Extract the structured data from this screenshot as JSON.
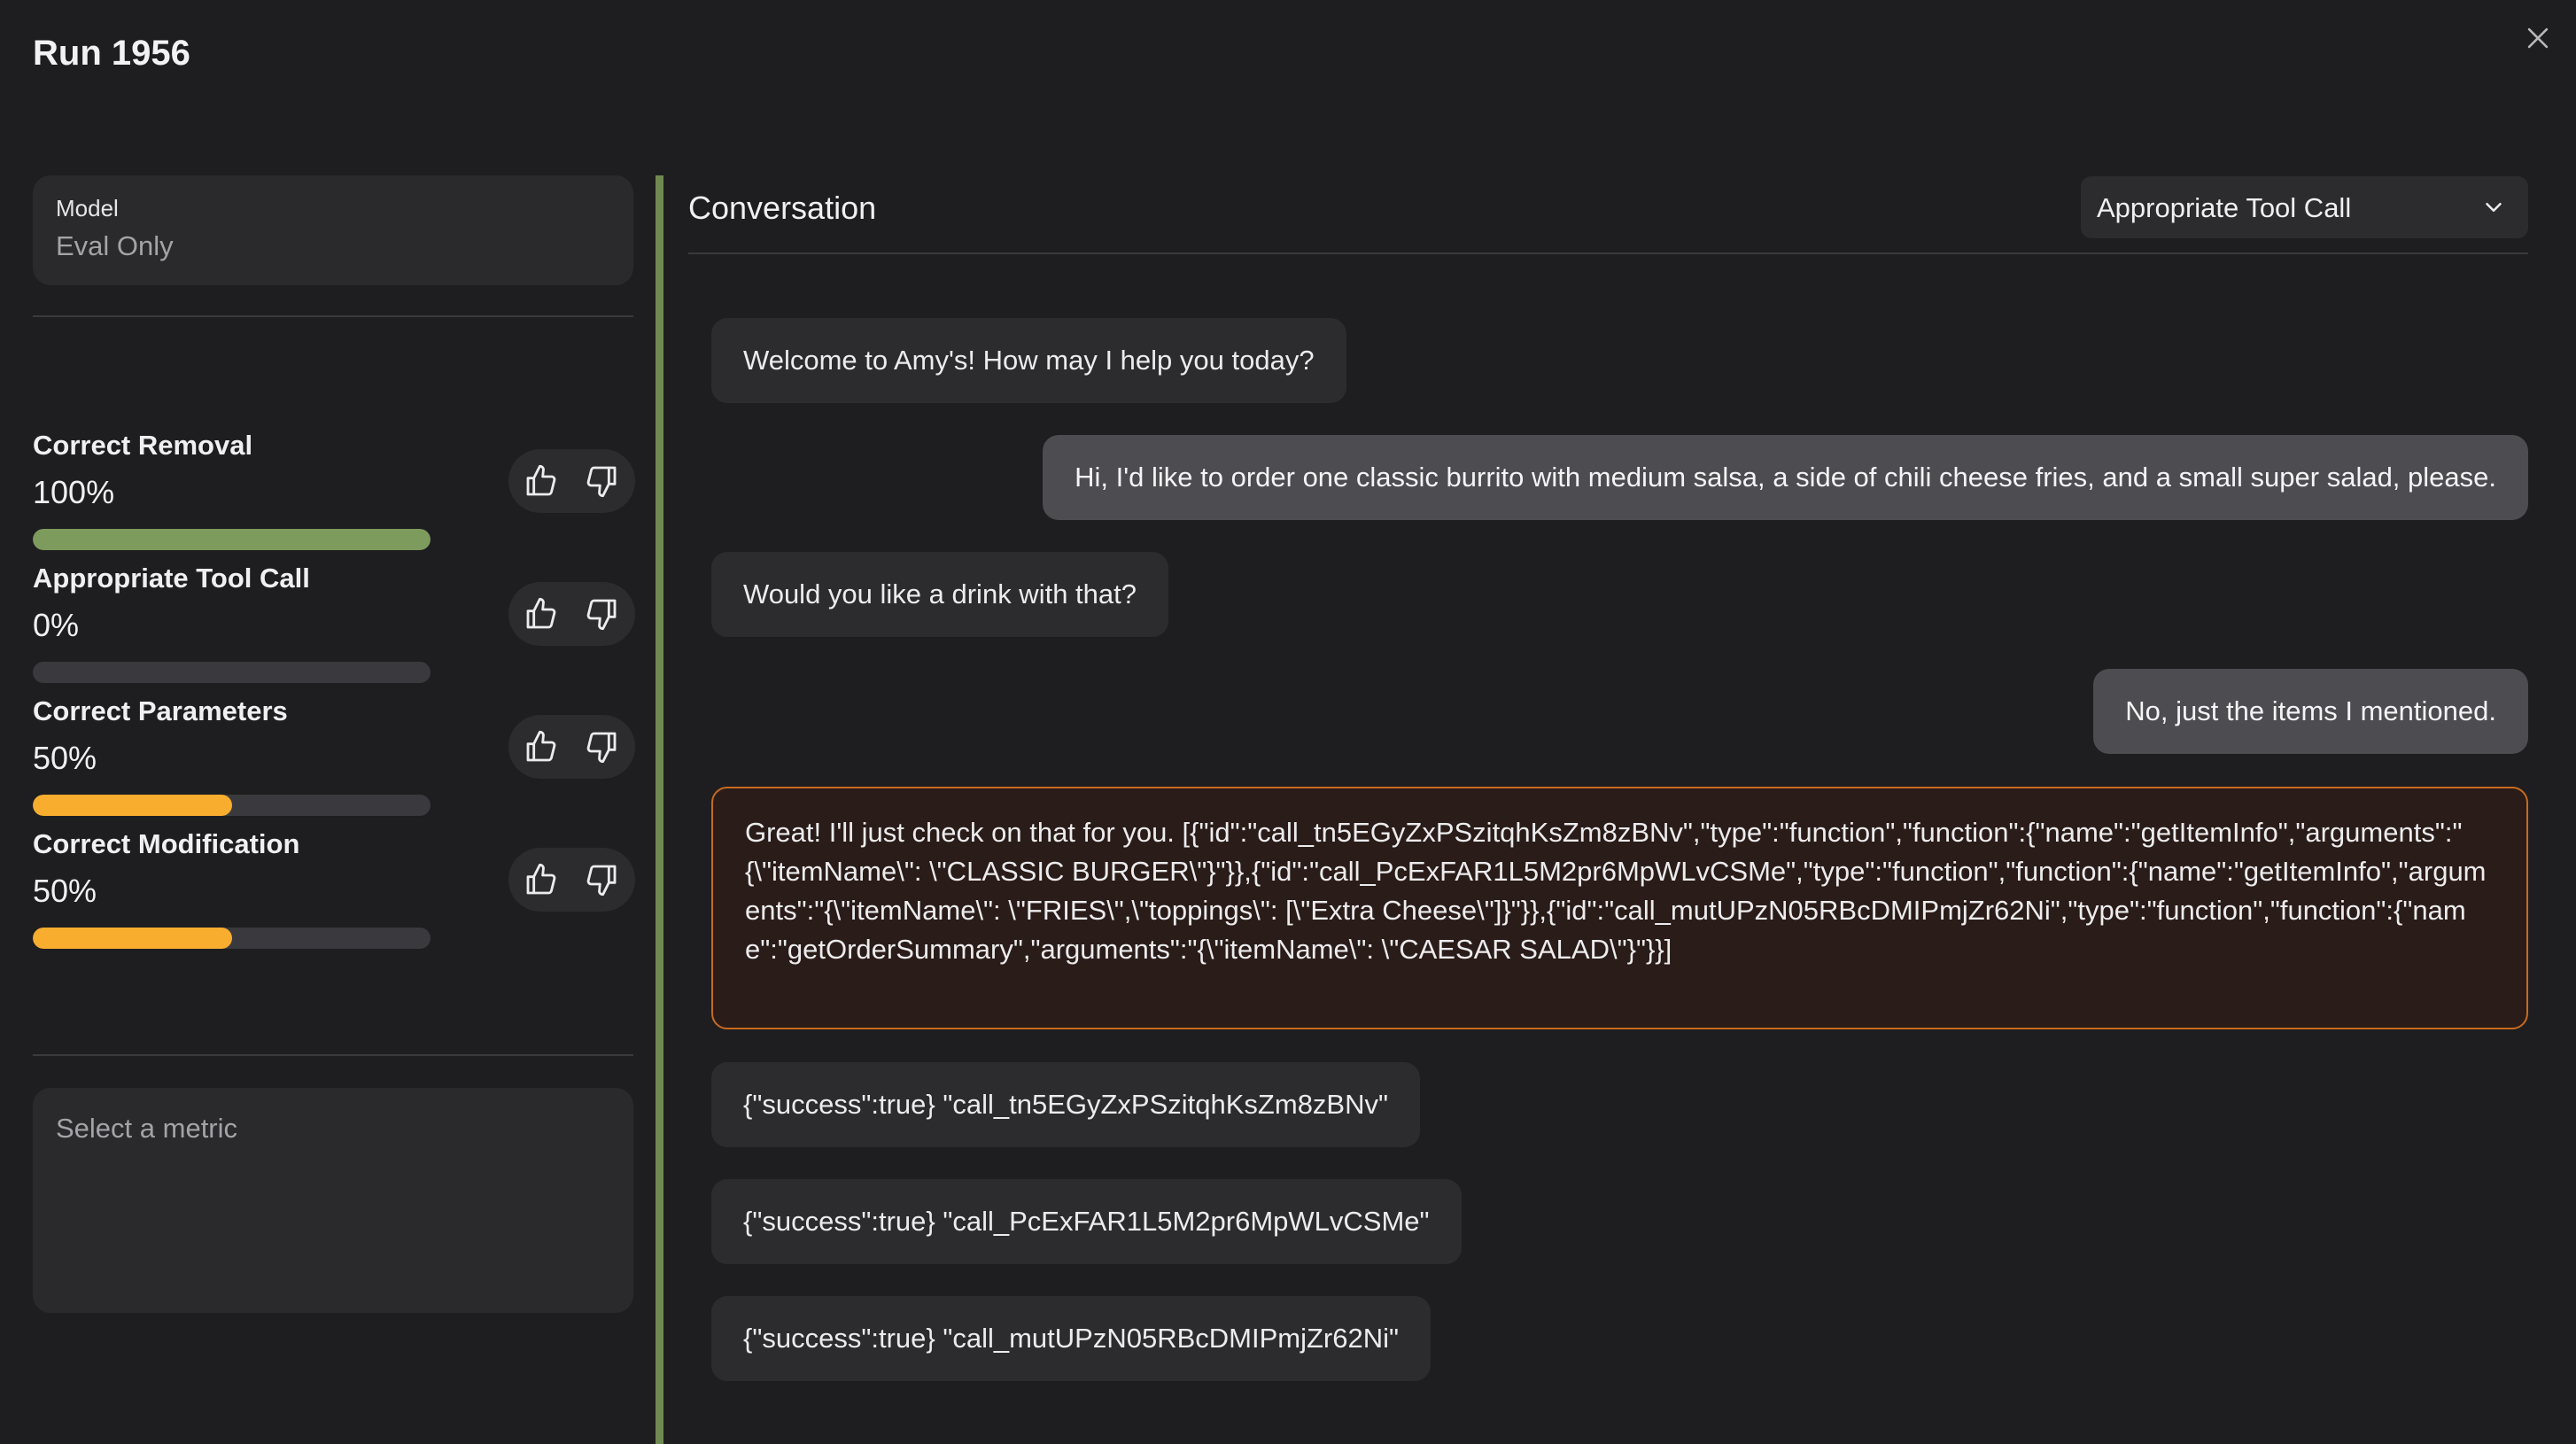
{
  "header": {
    "title": "Run 1956"
  },
  "model": {
    "label": "Model",
    "value": "Eval Only"
  },
  "metrics": [
    {
      "name": "Correct Removal",
      "value": "100%",
      "progress": 1.0,
      "color": "#7d9b5c"
    },
    {
      "name": "Appropriate Tool Call",
      "value": "0%",
      "progress": 0.0,
      "color": "#f8ad2f"
    },
    {
      "name": "Correct Parameters",
      "value": "50%",
      "progress": 0.5,
      "color": "#f8ad2f"
    },
    {
      "name": "Correct Modification",
      "value": "50%",
      "progress": 0.5,
      "color": "#f8ad2f"
    }
  ],
  "metric_detail": {
    "placeholder": "Select a metric"
  },
  "conversation": {
    "title": "Conversation",
    "filter_selected": "Appropriate Tool Call",
    "messages": [
      {
        "role": "assistant",
        "text": "Welcome to Amy's! How may I help you today?"
      },
      {
        "role": "user",
        "text": "Hi, I'd like to order one classic burrito with medium salsa, a side of chili cheese fries, and a small super salad, please."
      },
      {
        "role": "assistant",
        "text": "Would you like a drink with that?"
      },
      {
        "role": "user",
        "text": "No, just the items I mentioned."
      },
      {
        "role": "assistant",
        "text": "Great! I'll just check on that for you. [{\"id\":\"call_tn5EGyZxPSzitqhKsZm8zBNv\",\"type\":\"function\",\"function\":{\"name\":\"getItemInfo\",\"arguments\":\"{\\\"itemName\\\": \\\"CLASSIC BURGER\\\"}\"}},{\"id\":\"call_PcExFAR1L5M2pr6MpWLvCSMe\",\"type\":\"function\",\"function\":{\"name\":\"getItemInfo\",\"arguments\":\"{\\\"itemName\\\": \\\"FRIES\\\",\\\"toppings\\\": [\\\"Extra Cheese\\\"]}\"}},{\"id\":\"call_mutUPzN05RBcDMIPmjZr62Ni\",\"type\":\"function\",\"function\":{\"name\":\"getOrderSummary\",\"arguments\":\"{\\\"itemName\\\": \\\"CAESAR SALAD\\\"}\"}}]"
      },
      {
        "role": "tool",
        "text": "{\"success\":true} \"call_tn5EGyZxPSzitqhKsZm8zBNv\""
      },
      {
        "role": "tool",
        "text": "{\"success\":true} \"call_PcExFAR1L5M2pr6MpWLvCSMe\""
      },
      {
        "role": "tool",
        "text": "{\"success\":true} \"call_mutUPzN05RBcDMIPmjZr62Ni\""
      }
    ]
  },
  "icons": {
    "close": "close-icon",
    "thumbs_up": "thumbs-up-icon",
    "thumbs_down": "thumbs-down-icon",
    "chevron": "chevron-down-icon"
  },
  "colors": {
    "background": "#1e1e20",
    "accent_green": "#7d9b5c",
    "accent_orange": "#f8ad2f",
    "tool_call_border": "#c86a1f"
  }
}
